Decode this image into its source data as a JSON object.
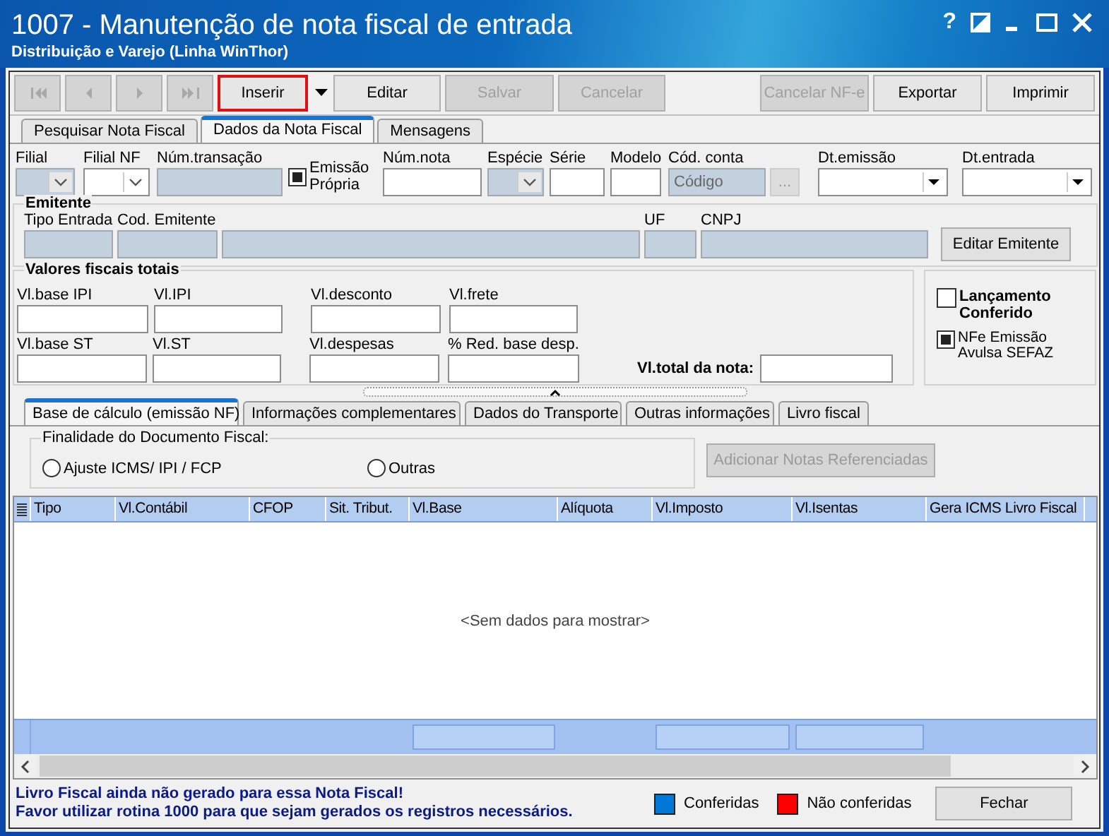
{
  "window": {
    "title": "1007 - Manutenção de nota fiscal de entrada",
    "subtitle": "Distribuição e Varejo (Linha WinThor)",
    "controls": [
      {
        "kind": "help",
        "label": "?"
      },
      {
        "kind": "theme"
      },
      {
        "kind": "minimize"
      },
      {
        "kind": "maximize"
      },
      {
        "kind": "close"
      }
    ]
  },
  "toolbar": {
    "left": [
      {
        "kind": "nav",
        "disabled": true
      },
      {
        "kind": "nav",
        "disabled": true
      },
      {
        "kind": "nav",
        "disabled": true
      },
      {
        "kind": "nav",
        "disabled": true
      },
      {
        "kind": "button",
        "label": "Inserir",
        "disabled": false,
        "highlighted": true
      },
      {
        "kind": "dropdown"
      },
      {
        "kind": "button",
        "label": "Editar",
        "disabled": false,
        "highlighted": false
      },
      {
        "kind": "button",
        "label": "Salvar",
        "disabled": true,
        "highlighted": false
      },
      {
        "kind": "button",
        "label": "Cancelar",
        "disabled": true,
        "highlighted": false
      }
    ],
    "right": [
      {
        "kind": "button",
        "label": "Cancelar NF-e",
        "disabled": true,
        "highlighted": false
      },
      {
        "kind": "button",
        "label": "Exportar",
        "disabled": false,
        "highlighted": false
      },
      {
        "kind": "button",
        "label": "Imprimir",
        "disabled": false,
        "highlighted": false
      }
    ]
  },
  "tabs": [
    {
      "label": "Pesquisar Nota Fiscal",
      "selected": false
    },
    {
      "label": "Dados da Nota Fiscal",
      "selected": true
    },
    {
      "label": "Mensagens",
      "selected": false
    }
  ],
  "header_fields": [
    {
      "label": "Filial",
      "kind": "combo",
      "disabled": true
    },
    {
      "label": "Filial NF",
      "kind": "combo",
      "disabled": false
    },
    {
      "label": "Núm.transação",
      "kind": "text",
      "disabled": true
    },
    {
      "label": "Emissão Própria",
      "kind": "check",
      "checked": true
    },
    {
      "label": "Núm.nota",
      "kind": "text",
      "disabled": false
    },
    {
      "label": "Espécie",
      "kind": "combo",
      "disabled": true
    },
    {
      "label": "Série",
      "kind": "text",
      "disabled": false
    },
    {
      "label": "Modelo",
      "kind": "text",
      "disabled": false
    },
    {
      "label": "Cód. conta",
      "kind": "lookup",
      "disabled": true,
      "placeholder": "Código",
      "button": "..."
    },
    {
      "label": "Dt.emissão",
      "kind": "date",
      "disabled": false
    },
    {
      "label": "Dt.entrada",
      "kind": "date",
      "disabled": false
    }
  ],
  "emitente": {
    "title": "Emitente",
    "fields": [
      {
        "label": "Tipo Entrada",
        "disabled": true
      },
      {
        "label": "Cod. Emitente",
        "disabled": true
      },
      {
        "disabled": true
      },
      {
        "label": "UF",
        "disabled": true
      },
      {
        "label": "CNPJ",
        "disabled": true
      }
    ],
    "button": "Editar Emitente"
  },
  "valores": {
    "title": "Valores fiscais totais",
    "rows": [
      [
        {
          "label": "Vl.base IPI"
        },
        {
          "label": "Vl.IPI"
        },
        {
          "label": "Vl.desconto"
        },
        {
          "label": "Vl.frete"
        }
      ],
      [
        {
          "label": "Vl.base ST"
        },
        {
          "label": "Vl.ST"
        },
        {
          "label": "Vl.despesas"
        },
        {
          "label": "% Red. base desp."
        }
      ]
    ],
    "total_label": "Vl.total da nota:"
  },
  "status_checks": [
    {
      "label": "Lançamento Conferido",
      "checked": false,
      "bold": true
    },
    {
      "label": "NFe Emissão Avulsa SEFAZ",
      "checked": true,
      "bold": false
    }
  ],
  "sub_tabs": [
    {
      "label": "Base de cálculo (emissão NF)",
      "selected": true
    },
    {
      "label": "Informações complementares",
      "selected": false
    },
    {
      "label": "Dados do Transporte",
      "selected": false
    },
    {
      "label": "Outras informações",
      "selected": false
    },
    {
      "label": "Livro fiscal",
      "selected": false
    }
  ],
  "finalidade": {
    "title": "Finalidade do Documento Fiscal:",
    "options": [
      {
        "label": "Ajuste ICMS/ IPI / FCP",
        "selected": false
      },
      {
        "label": "Outras",
        "selected": false
      }
    ]
  },
  "add_button": {
    "label": "Adicionar Notas Referenciadas",
    "disabled": true
  },
  "grid": {
    "columns": [
      {
        "label": "Tipo"
      },
      {
        "label": "Vl.Contábil"
      },
      {
        "label": "CFOP"
      },
      {
        "label": "Sit. Tribut."
      },
      {
        "label": "Vl.Base"
      },
      {
        "label": "Alíquota"
      },
      {
        "label": "Vl.Imposto"
      },
      {
        "label": "Vl.Isentas"
      },
      {
        "label": "Gera ICMS Livro Fiscal"
      }
    ],
    "empty_text": "<Sem dados para mostrar>"
  },
  "footer": {
    "messages": [
      "Livro Fiscal ainda não gerado para essa Nota Fiscal!",
      "Favor utilizar rotina 1000 para que sejam gerados os registros necessários."
    ],
    "legend": [
      {
        "label": "Conferidas",
        "color": "#0078d7"
      },
      {
        "label": "Não conferidas",
        "color": "#ff0000"
      }
    ],
    "close_button": "Fechar"
  }
}
